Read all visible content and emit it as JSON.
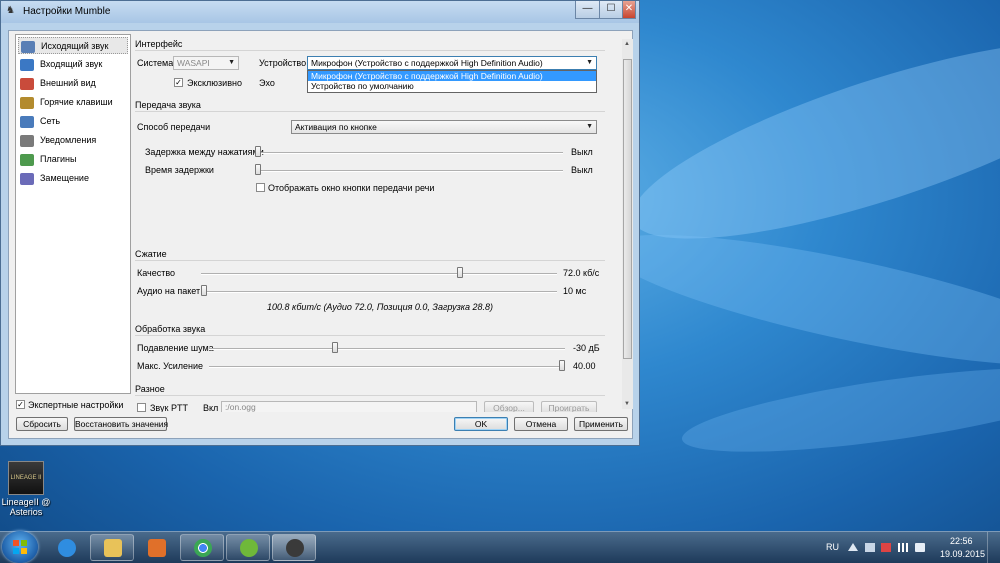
{
  "window": {
    "title": "Настройки Mumble",
    "buttons": {
      "minimize": "—",
      "maximize": "☐",
      "close": "✕"
    }
  },
  "sidebar": {
    "items": [
      {
        "label": "Исходящий звук",
        "icon": "microphone-icon",
        "color": "#5a7fb5"
      },
      {
        "label": "Входящий звук",
        "icon": "speaker-icon",
        "color": "#3b78c4"
      },
      {
        "label": "Внешний вид",
        "icon": "appearance-icon",
        "color": "#c94b3b"
      },
      {
        "label": "Горячие клавиши",
        "icon": "keyboard-icon",
        "color": "#b38b2e"
      },
      {
        "label": "Сеть",
        "icon": "network-icon",
        "color": "#4a7bbb"
      },
      {
        "label": "Уведомления",
        "icon": "notifications-icon",
        "color": "#7a7a7a"
      },
      {
        "label": "Плагины",
        "icon": "plugins-icon",
        "color": "#4e9a4e"
      },
      {
        "label": "Замещение",
        "icon": "overlay-icon",
        "color": "#6b6bb8"
      }
    ]
  },
  "interface": {
    "title": "Интерфейс",
    "system_label": "Система",
    "system_value": "WASAPI",
    "device_label": "Устройство",
    "device_value": "Микрофон (Устройство с поддержкой High Definition Audio)",
    "dropdown_options": [
      "Микрофон (Устройство с поддержкой High Definition Audio)",
      "Устройство по умолчанию"
    ],
    "exclusive_label": "Эксклюзивно",
    "exclusive_checked": "✓",
    "echo_label": "Эхо"
  },
  "transmission": {
    "title": "Передача звука",
    "method_label": "Способ передачи",
    "method_value": "Активация по кнопке",
    "delay_between_label": "Задержка между нажатиями",
    "delay_between_value": "Выкл",
    "delay_label": "Время задержки",
    "delay_value": "Выкл",
    "show_ptt_window_label": "Отображать окно кнопки передачи речи"
  },
  "compression": {
    "title": "Сжатие",
    "quality_label": "Качество",
    "quality_value": "72.0 кб/с",
    "quality_level": 0.73,
    "audio_per_packet_label": "Аудио на пакет",
    "audio_per_packet_value": "10 мс",
    "audio_per_packet_level": 0.0,
    "summary": "100.8 кбит/с (Аудио 72.0, Позиция 0.0, Загрузка 28.8)"
  },
  "processing": {
    "title": "Обработка звука",
    "noise_label": "Подавление шума",
    "noise_value": "-30 дБ",
    "noise_level": 0.35,
    "gain_label": "Макс. Усиление",
    "gain_value": "40.00",
    "gain_level": 1.0
  },
  "misc": {
    "title": "Разное",
    "ptt_sound_label": "Звук PTT",
    "on_label": "Вкл",
    "on_path": ":/on.ogg",
    "browse_label": "Обзор...",
    "play_label": "Проиграть"
  },
  "footer": {
    "expert_label": "Экспертные настройки",
    "expert_checked": "✓",
    "reset_label": "Сбросить",
    "restore_label": "Восстановить значения",
    "ok_label": "OK",
    "cancel_label": "Отмена",
    "apply_label": "Применить"
  },
  "desktop": {
    "icon_label_line1": "LineageII @",
    "icon_label_line2": "Asterios",
    "icon_text": "LINEAGE II"
  },
  "taskbar": {
    "apps": [
      {
        "name": "internet-explorer-icon",
        "color": "#2f8de0"
      },
      {
        "name": "file-explorer-icon",
        "color": "#e8c259"
      },
      {
        "name": "media-player-icon",
        "color": "#e0702a"
      },
      {
        "name": "chrome-icon",
        "color": "#3aa655"
      },
      {
        "name": "utorrent-icon",
        "color": "#6fb83a"
      },
      {
        "name": "mumble-icon",
        "color": "#3a3a3a"
      }
    ],
    "language": "RU",
    "time": "22:56",
    "date": "19.09.2015"
  }
}
